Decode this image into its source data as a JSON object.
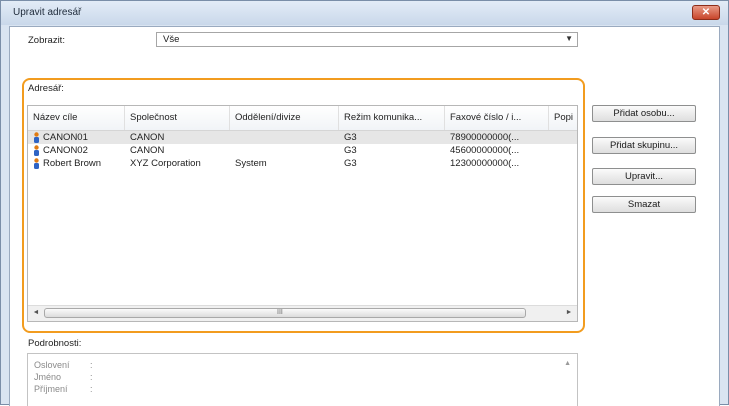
{
  "window": {
    "title": "Upravit adresář",
    "close_label": "✕"
  },
  "filter": {
    "label": "Zobrazit:",
    "value": "Vše"
  },
  "group_label": "Adresář:",
  "list": {
    "columns": [
      "Název cíle",
      "Společnost",
      "Oddělení/divize",
      "Režim komunika...",
      "Faxové číslo / i...",
      "Popi"
    ],
    "rows": [
      {
        "name": "CANON01",
        "company": "CANON",
        "department": "",
        "mode": "G3",
        "fax": "78900000000(...",
        "selected": true
      },
      {
        "name": "CANON02",
        "company": "CANON",
        "department": "",
        "mode": "G3",
        "fax": "45600000000(...",
        "selected": false
      },
      {
        "name": "Robert Brown",
        "company": "XYZ Corporation",
        "department": "System",
        "mode": "G3",
        "fax": "12300000000(...",
        "selected": false
      }
    ],
    "scroll_left": "◄",
    "scroll_right": "►",
    "scroll_grip": "III"
  },
  "buttons": {
    "add_person": "Přidat osobu...",
    "add_group": "Přidat skupinu...",
    "edit": "Upravit...",
    "delete": "Smazat"
  },
  "details": {
    "label": "Podrobnosti:",
    "fields": [
      "Oslovení",
      "Jméno",
      "Příjmení"
    ],
    "colon": ":",
    "scroll_up": "▲"
  },
  "colors": {
    "accent": "#f29c1f",
    "icon_orange": "#e07b12",
    "icon_blue": "#2f64c4"
  }
}
